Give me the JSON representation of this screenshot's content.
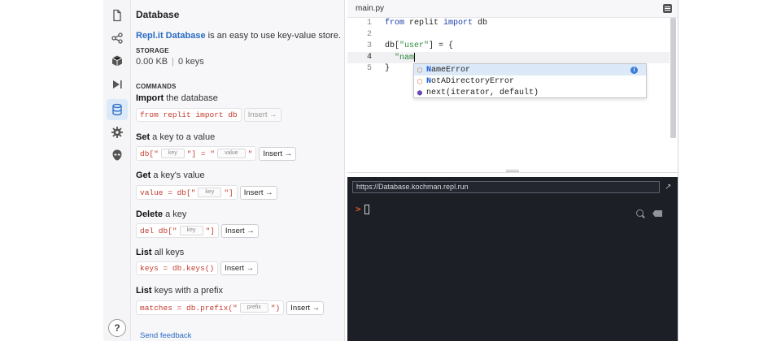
{
  "rail": {
    "icons": [
      "file-icon",
      "share-icon",
      "package-icon",
      "play-icon",
      "database-icon",
      "gear-icon",
      "alien-icon"
    ],
    "help_label": "?"
  },
  "database_panel": {
    "title": "Database",
    "description_link": "Repl.it Database",
    "description_rest": " is an easy to use key-value store.",
    "storage_label": "STORAGE",
    "storage_size": "0.00 KB",
    "storage_keys": "0 keys",
    "storage_sep": "|",
    "commands_label": "COMMANDS",
    "commands": [
      {
        "verb": "Import",
        "rest": " the database",
        "code": [
          "from replit import db"
        ],
        "placeholders": [],
        "insert": "Insert →"
      },
      {
        "verb": "Set",
        "rest": " a key to a value",
        "code": [
          "db[\"",
          "\"] = \"",
          "\""
        ],
        "placeholders": [
          "key",
          "value"
        ],
        "insert": "Insert →"
      },
      {
        "verb": "Get",
        "rest": " a key's value",
        "code": [
          "value = db[\"",
          "\"]"
        ],
        "placeholders": [
          "key"
        ],
        "insert": "Insert →"
      },
      {
        "verb": "Delete",
        "rest": " a key",
        "code": [
          "del db[\"",
          "\"]"
        ],
        "placeholders": [
          "key"
        ],
        "insert": "Insert →"
      },
      {
        "verb": "List",
        "rest": " all keys",
        "code": [
          "keys = db.keys()"
        ],
        "placeholders": [],
        "insert": "Insert →"
      },
      {
        "verb": "List",
        "rest": " keys with a prefix",
        "code": [
          "matches = db.prefix(\"",
          "\")"
        ],
        "placeholders": [
          "prefix"
        ],
        "insert": "Insert →"
      }
    ],
    "feedback": "Send feedback"
  },
  "editor": {
    "tab": "main.py",
    "line_numbers": [
      "1",
      "2",
      "3",
      "4",
      "5"
    ],
    "lines": {
      "l1_kw1": "from",
      "l1_mid": " replit ",
      "l1_kw2": "import",
      "l1_end": " db",
      "l3_a": "db[",
      "l3_str": "\"user\"",
      "l3_b": "] = {",
      "l4_str": "  \"nam",
      "l5": "}"
    },
    "autocomplete": [
      {
        "match": "N",
        "text": "ameError",
        "icon": "class-icon"
      },
      {
        "match": "N",
        "text": "otADirectoryError",
        "icon": "class-icon"
      },
      {
        "match": "",
        "text": "next(iterator, default)",
        "icon": "function-icon"
      }
    ]
  },
  "console": {
    "url": "https://Database.kochman.repl.run",
    "prompt": ">"
  }
}
